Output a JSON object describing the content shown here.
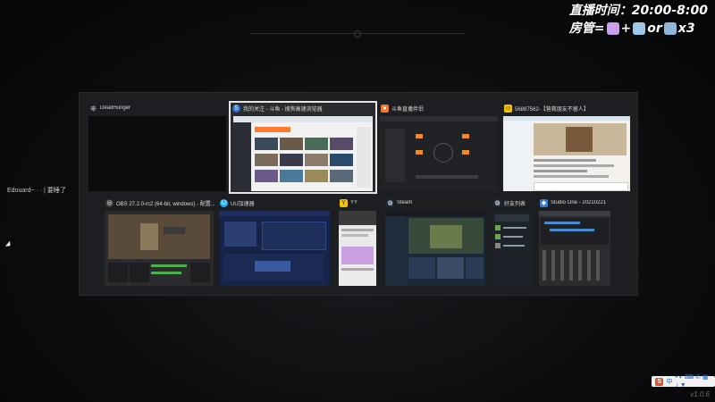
{
  "overlay": {
    "schedule_label": "直播时间：20:00-8:00",
    "mgr_label": "房管=",
    "mgr_plus": "+",
    "mgr_or": "or",
    "mgr_x3": "x3"
  },
  "sidebar": {
    "user": "Edouard~ ·  ·  |  要睡了"
  },
  "windows": [
    {
      "title": "DeadHunger",
      "icon": "ship-wheel-icon",
      "accent": "#3a3a3a"
    },
    {
      "title": "我的关注 - 斗鱼 - 搜狗高速浏览器",
      "icon": "sogou-browser-icon",
      "accent": "#2b6fd6"
    },
    {
      "title": "斗鱼直播伴侣",
      "icon": "douyu-companion-icon",
      "accent": "#f0782a"
    },
    {
      "title": "56887562-【营救朋友不留人】",
      "icon": "chat-icon",
      "accent": "#f5c000"
    },
    {
      "title": "OBS 27.2.0-rc2 (64-bit, windows) - 配置...",
      "icon": "obs-icon",
      "accent": "#5a5a5a"
    },
    {
      "title": "UU加速器",
      "icon": "uu-accelerator-icon",
      "accent": "#1ab2ff"
    },
    {
      "title": "YY",
      "icon": "yy-icon",
      "accent": "#f5c000"
    },
    {
      "title": "Steam",
      "icon": "steam-icon",
      "accent": "#1b2838"
    },
    {
      "title": "好友列表",
      "icon": "steam-friends-icon",
      "accent": "#1b2838"
    },
    {
      "title": "Studio One - 20210221",
      "icon": "studio-one-icon",
      "accent": "#3a7bd5"
    }
  ],
  "tray": {
    "input_lang": "中",
    "symbols": "• ◐ ⌨ ✆ ▦ ♪ ▼"
  },
  "version": "v1.0.6"
}
